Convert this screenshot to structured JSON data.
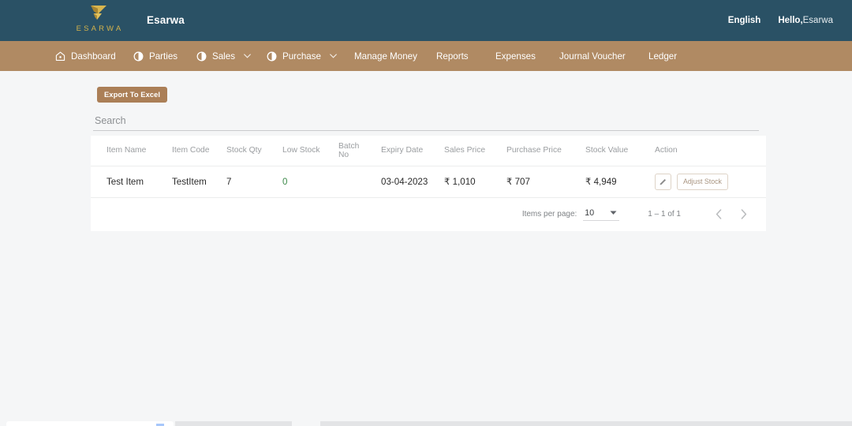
{
  "header": {
    "logo_word": "ESARWA",
    "logo_icon": "esarwa-arrow-logo",
    "app_title": "Esarwa",
    "language": "English",
    "greeting_prefix": "Hello,",
    "user_name": "Esarwa",
    "bg_color": "#2a5165",
    "logo_color": "#d3b24c"
  },
  "nav": {
    "bg_color": "#b08a63",
    "items": [
      {
        "label": "Dashboard",
        "icon": "home-icon",
        "caret": false
      },
      {
        "label": "Parties",
        "icon": "contrast-icon",
        "caret": false
      },
      {
        "label": "Sales",
        "icon": "contrast-icon",
        "caret": true
      },
      {
        "label": "Purchase",
        "icon": "contrast-icon",
        "caret": true
      },
      {
        "label": "Manage Money",
        "icon": "none",
        "caret": false
      },
      {
        "label": "Reports",
        "icon": "none",
        "caret": false
      },
      {
        "label": "Expenses",
        "icon": "none",
        "caret": false
      },
      {
        "label": "Journal Voucher",
        "icon": "none",
        "caret": false
      },
      {
        "label": "Ledger",
        "icon": "none",
        "caret": false
      }
    ]
  },
  "toolbar": {
    "export_label": "Export To Excel",
    "export_bg": "#ab7f57"
  },
  "search": {
    "value": "",
    "placeholder": "Search"
  },
  "table": {
    "columns": [
      "Item Name",
      "Item Code",
      "Stock Qty",
      "Low Stock",
      "Batch No",
      "Expiry Date",
      "Sales Price",
      "Purchase Price",
      "Stock Value",
      "Action"
    ],
    "rows": [
      {
        "item_name": "Test Item",
        "item_code": "TestItem",
        "stock_qty": "7",
        "low_stock": "0",
        "low_stock_color": "#3d8a4a",
        "batch_no": "",
        "expiry_date": "03-04-2023",
        "sales_price": "₹ 1,010",
        "purchase_price": "₹ 707",
        "stock_value": "₹ 4,949",
        "edit_icon": "pencil-icon",
        "adjust_label": "Adjust Stock"
      }
    ]
  },
  "paginator": {
    "items_per_page_label": "Items per page:",
    "items_per_page_value": "10",
    "range_label": "1 – 1 of 1",
    "prev_icon": "chevron-left-icon",
    "next_icon": "chevron-right-icon"
  }
}
